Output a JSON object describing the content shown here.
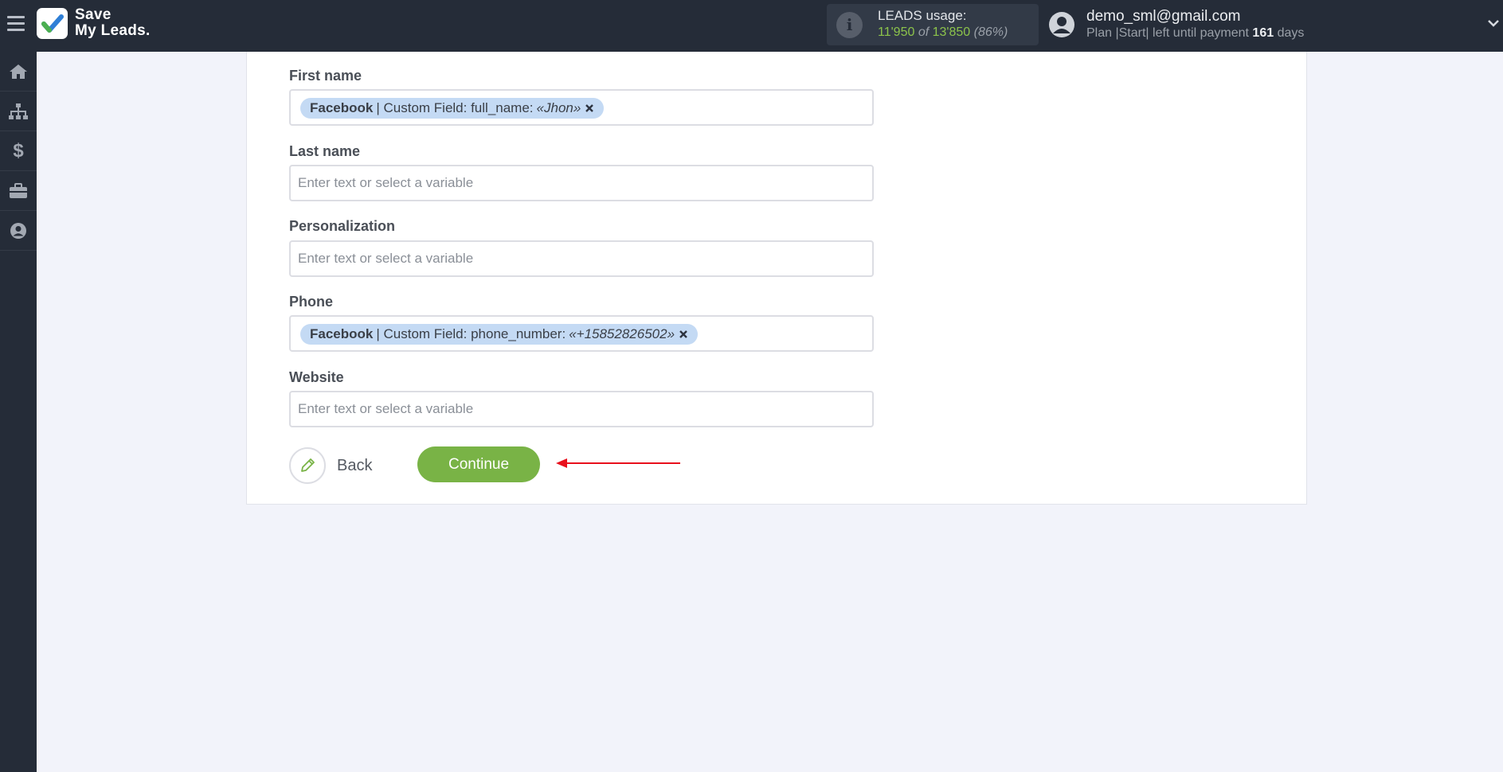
{
  "brand": {
    "line1": "Save",
    "line2": "My Leads."
  },
  "usage": {
    "title": "LEADS usage:",
    "used": "11'950",
    "of": "of",
    "total": "13'850",
    "percent": "(86%)"
  },
  "user": {
    "email": "demo_sml@gmail.com",
    "plan_prefix": "Plan |Start| left until payment",
    "days": "161",
    "days_suffix": "days"
  },
  "sidebar": {
    "items": [
      {
        "icon": "home-icon"
      },
      {
        "icon": "sitemap-icon"
      },
      {
        "icon": "dollar-icon"
      },
      {
        "icon": "briefcase-icon"
      },
      {
        "icon": "user-circle-icon"
      }
    ]
  },
  "form": {
    "placeholder": "Enter text or select a variable",
    "fields": [
      {
        "label": "First name",
        "chip": {
          "source": "Facebook",
          "text": "| Custom Field: full_name:",
          "value": "«Jhon»"
        }
      },
      {
        "label": "Last name"
      },
      {
        "label": "Personalization"
      },
      {
        "label": "Phone",
        "chip": {
          "source": "Facebook",
          "text": "| Custom Field: phone_number:",
          "value": "«+15852826502»"
        }
      },
      {
        "label": "Website"
      }
    ],
    "back_label": "Back",
    "continue_label": "Continue"
  },
  "colors": {
    "topbar": "#252c38",
    "accent_green": "#79b346",
    "chip_blue": "#c4daf4",
    "arrow_red": "#e8101c"
  }
}
